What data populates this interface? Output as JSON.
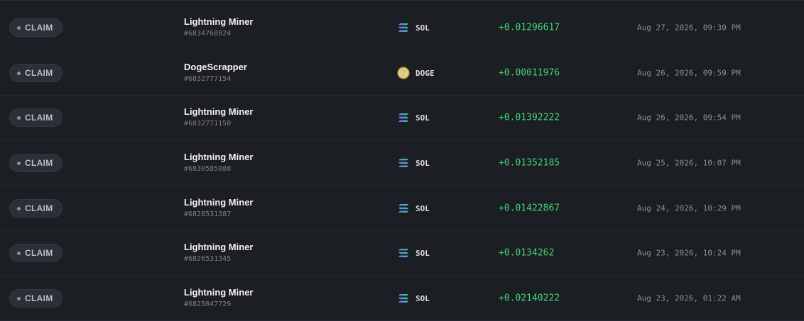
{
  "rows": [
    {
      "type": "CLAIM",
      "game": "Lightning Miner",
      "id": "#6834768824",
      "currency": "SOL",
      "coin_icon": "solana-icon",
      "amount": "+0.01296617",
      "date": "Aug 27, 2026, 09:30 PM"
    },
    {
      "type": "CLAIM",
      "game": "DogeScrapper",
      "id": "#6832777154",
      "currency": "DOGE",
      "coin_icon": "dogecoin-icon",
      "amount": "+0.00011976",
      "date": "Aug 26, 2026, 09:59 PM"
    },
    {
      "type": "CLAIM",
      "game": "Lightning Miner",
      "id": "#6832771150",
      "currency": "SOL",
      "coin_icon": "solana-icon",
      "amount": "+0.01392222",
      "date": "Aug 26, 2026, 09:54 PM"
    },
    {
      "type": "CLAIM",
      "game": "Lightning Miner",
      "id": "#6830585088",
      "currency": "SOL",
      "coin_icon": "solana-icon",
      "amount": "+0.01352185",
      "date": "Aug 25, 2026, 10:07 PM"
    },
    {
      "type": "CLAIM",
      "game": "Lightning Miner",
      "id": "#6828531387",
      "currency": "SOL",
      "coin_icon": "solana-icon",
      "amount": "+0.01422867",
      "date": "Aug 24, 2026, 10:29 PM"
    },
    {
      "type": "CLAIM",
      "game": "Lightning Miner",
      "id": "#6826531345",
      "currency": "SOL",
      "coin_icon": "solana-icon",
      "amount": "+0.0134262",
      "date": "Aug 23, 2026, 10:24 PM"
    },
    {
      "type": "CLAIM",
      "game": "Lightning Miner",
      "id": "#6825047729",
      "currency": "SOL",
      "coin_icon": "solana-icon",
      "amount": "+0.02140222",
      "date": "Aug 23, 2026, 01:22 AM"
    }
  ],
  "colors": {
    "positive_amount": "#3fd67a",
    "background": "#1b1e23"
  }
}
